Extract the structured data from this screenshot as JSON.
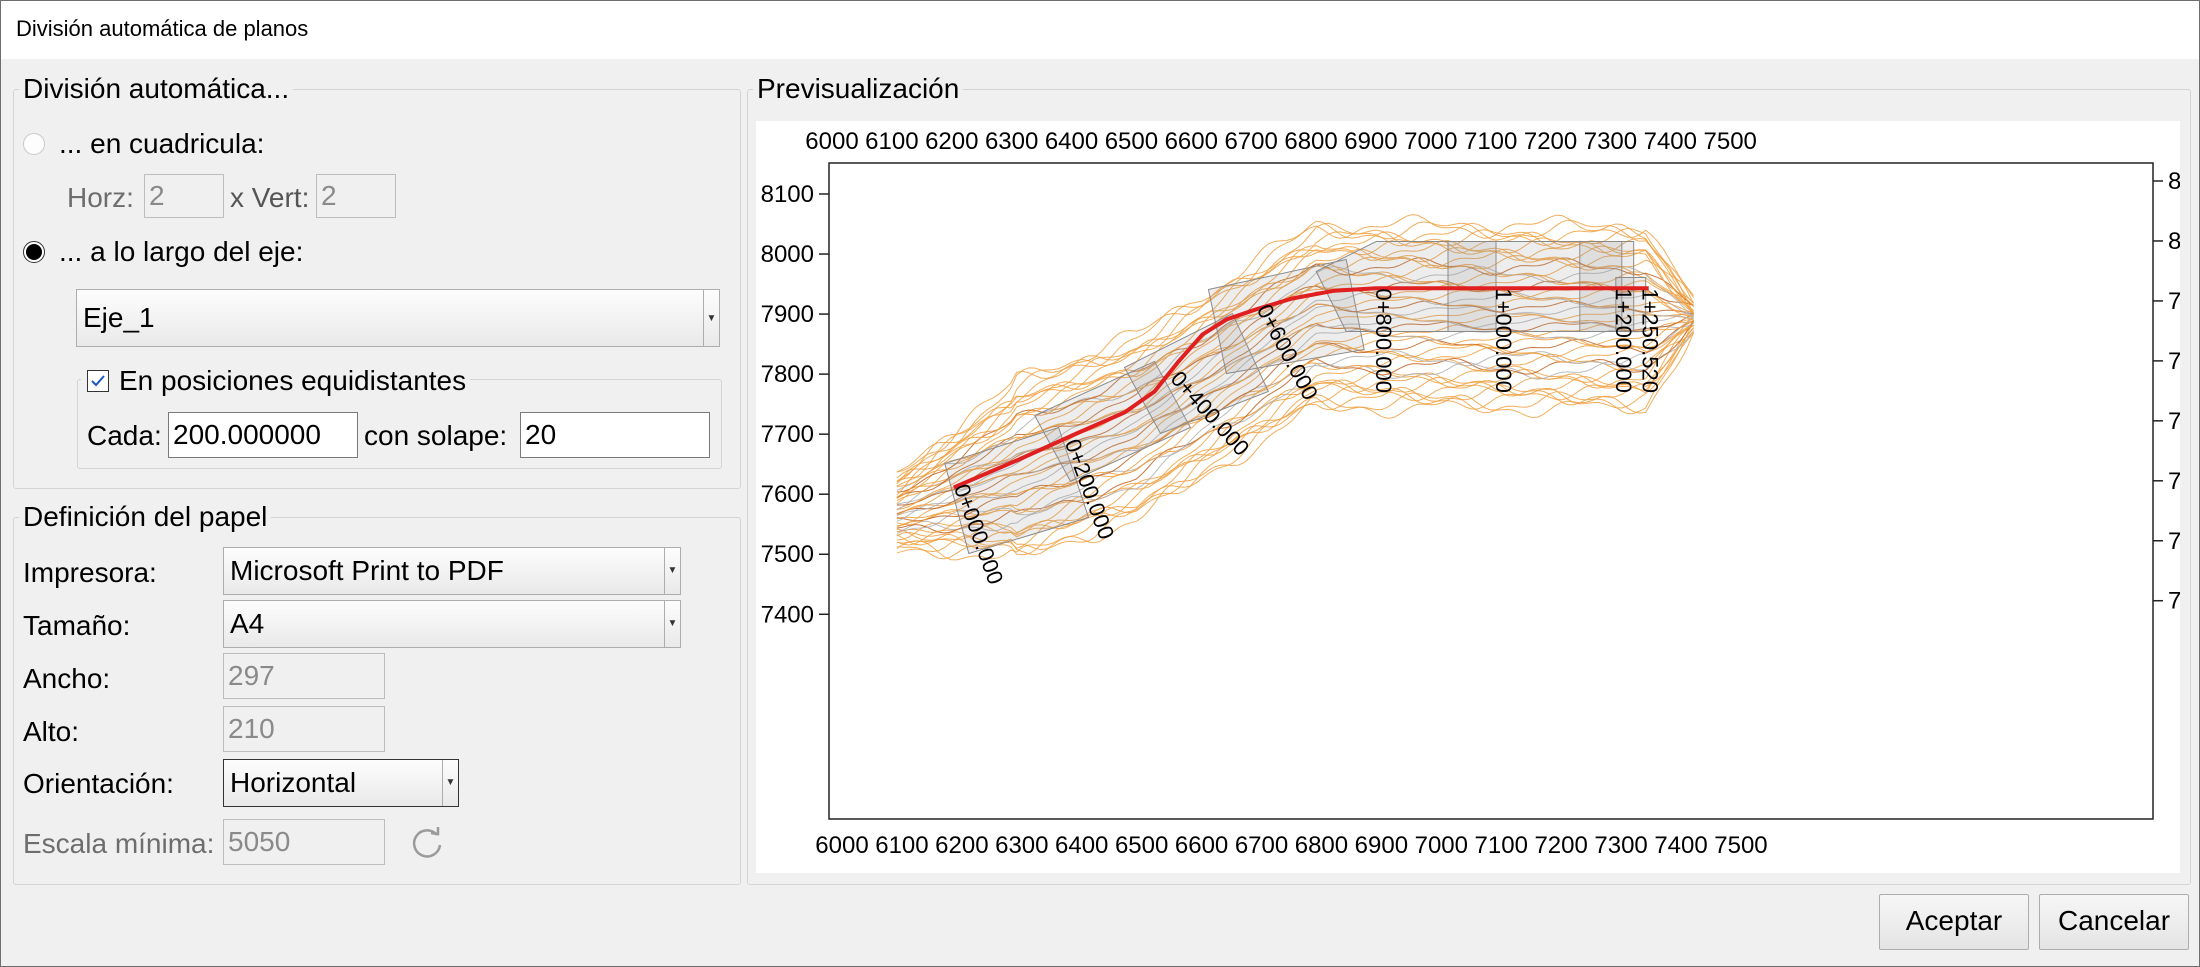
{
  "window": {
    "title": "División automática de planos"
  },
  "division": {
    "legend": "División automática...",
    "grid_option": {
      "label": "... en cuadricula:",
      "selected": false
    },
    "horz_label": "Horz:",
    "horz_value": "2",
    "vert_label": "x Vert:",
    "vert_value": "2",
    "axis_option": {
      "label": "... a lo largo del eje:",
      "selected": true
    },
    "axis_value": "Eje_1",
    "equidistant": {
      "label": "En posiciones equidistantes",
      "checked": true,
      "cada_label": "Cada:",
      "cada_value": "200.000000",
      "solape_label": "con solape:",
      "solape_value": "20"
    }
  },
  "paper": {
    "legend": "Definición del papel",
    "printer_label": "Impresora:",
    "printer_value": "Microsoft Print to PDF",
    "size_label": "Tamaño:",
    "size_value": "A4",
    "width_label": "Ancho:",
    "width_value": "297",
    "height_label": "Alto:",
    "height_value": "210",
    "orientation_label": "Orientación:",
    "orientation_value": "Horizontal",
    "min_scale_label": "Escala mínima:",
    "min_scale_value": "5050",
    "refresh_icon": "refresh-icon"
  },
  "preview": {
    "legend": "Previsualización",
    "x_ticks": [
      "6000",
      "6100",
      "6200",
      "6300",
      "6400",
      "6500",
      "6600",
      "6700",
      "6800",
      "6900",
      "7000",
      "7100",
      "7200",
      "7300",
      "7400",
      "7500"
    ],
    "y_ticks": [
      "8100",
      "8000",
      "7900",
      "7800",
      "7700",
      "7600",
      "7500",
      "7400"
    ],
    "stations": [
      "0+000.000",
      "0+200.000",
      "0+400.000",
      "0+600.000",
      "0+800.000",
      "1+000.000",
      "1+200.000",
      "1+250.520"
    ],
    "axis_color": "#e02020",
    "contour_colors": [
      "#f0a040",
      "#c06020",
      "#b0b0b0"
    ]
  },
  "buttons": {
    "ok": "Aceptar",
    "cancel": "Cancelar"
  }
}
